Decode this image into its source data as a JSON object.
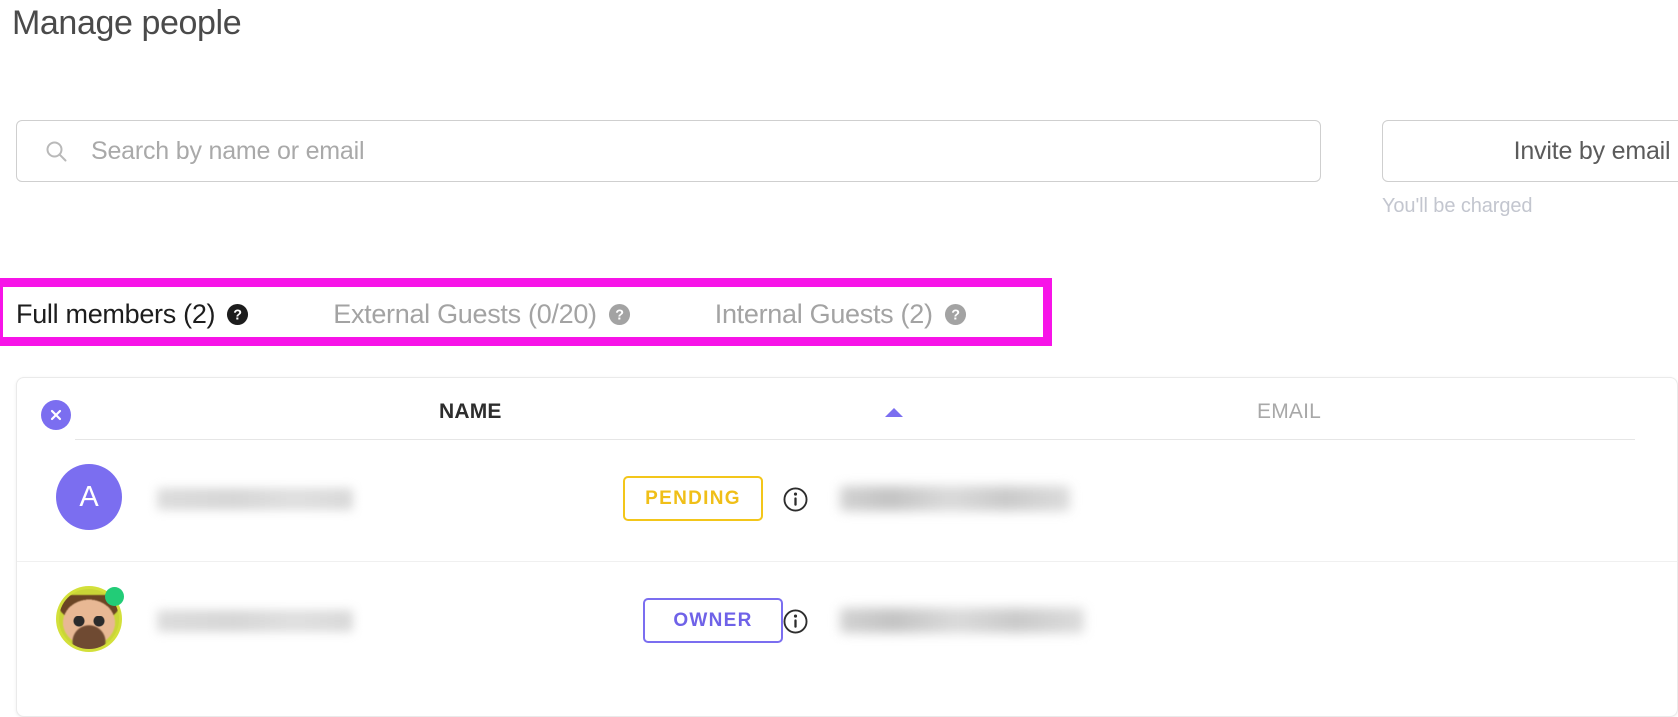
{
  "page": {
    "title": "Manage people"
  },
  "search": {
    "icon": "search-icon",
    "value": "",
    "placeholder": "Search by name or email"
  },
  "invite": {
    "button_label": "Invite by email",
    "note": "You'll be charged"
  },
  "highlight": {
    "color": "#f714e8"
  },
  "tabs": [
    {
      "label": "Full members (2)",
      "active": true,
      "help_icon": "help-circle-icon"
    },
    {
      "label": "External Guests (0/20)",
      "active": false,
      "help_icon": "help-circle-icon"
    },
    {
      "label": "Internal Guests (2)",
      "active": false,
      "help_icon": "help-circle-icon"
    }
  ],
  "table": {
    "clear_selection_icon": "close-circle-icon",
    "columns": {
      "name": "NAME",
      "email": "EMAIL"
    },
    "sort": {
      "column": "NAME",
      "direction": "asc",
      "icon": "sort-ascending-arrow-icon",
      "color": "#7b6ef0"
    },
    "rows": [
      {
        "avatar_type": "letter",
        "avatar_letter": "A",
        "avatar_color": "#7b6ef0",
        "name": "",
        "name_redacted": true,
        "role": "PENDING",
        "role_color": "#f0bf18",
        "info_icon": "info-circle-icon",
        "email": "",
        "email_redacted": true,
        "presence": ""
      },
      {
        "avatar_type": "photo",
        "avatar_letter": "",
        "avatar_color": "#c9d637",
        "name": "",
        "name_redacted": true,
        "role": "OWNER",
        "role_color": "#6f62e8",
        "info_icon": "info-circle-icon",
        "email": "",
        "email_redacted": true,
        "presence": "online"
      }
    ]
  }
}
